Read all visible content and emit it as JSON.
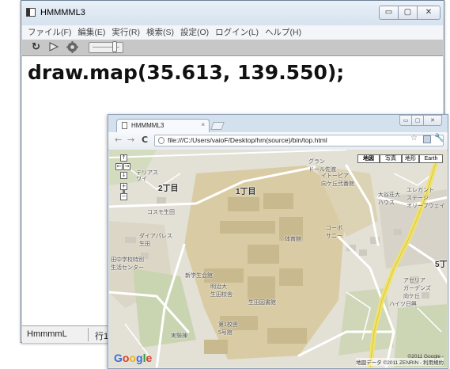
{
  "main_window": {
    "title": "HMMMML3",
    "controls": {
      "minimize": "▭",
      "maximize": "▢",
      "close": "✕"
    },
    "menu": [
      "ファイル(F)",
      "編集(E)",
      "実行(R)",
      "検索(S)",
      "設定(O)",
      "ログイン(L)",
      "ヘルプ(H)"
    ],
    "toolbar": {
      "reload_icon": "reload-icon",
      "play_icon": "play-icon",
      "settings_icon": "gear-icon"
    },
    "editor": {
      "code": "draw.map(35.613, 139.550);"
    },
    "status": {
      "name": "HmmmmL",
      "line": "行1"
    }
  },
  "browser": {
    "tab_title": "HMMMML3",
    "tab_close": "×",
    "url": "file:///C:/Users/vaioF/Desktop/hm(source)/bin/top.html",
    "map": {
      "types": [
        "地図",
        "写真",
        "地形",
        "Earth"
      ],
      "active_type": "地図",
      "labels": {
        "chome2": "2丁目",
        "chome1": "1丁目",
        "chome5": "5丁",
        "terrace": "テリアス",
        "wai": "ワイ",
        "kosumo": "コスモ生田",
        "daiapalace": "ダイアパレス\n生田",
        "school": "田中学校特別\n生活センター",
        "gran": "グラン\nドール佐渡",
        "eterna": "イトーピア\n向ケ丘弐番館",
        "elegant": "エレガント\nステージ\nオリーブウェイ",
        "ogisoi": "大谷荘大\nハウス",
        "kopo": "コーポ\nサニー",
        "acerea": "アセリア\nガーデンズ\n向ケ丘",
        "heights": "ハイツ日興",
        "library": "生田図書館",
        "taiikukan": "体育館",
        "scitech": "新学生会館",
        "meiji": "明治大\n生田校舎",
        "building": "第1校舎\n5号館",
        "rikagaku": "実験棟"
      },
      "attribution": "地図データ ©2011 ZENRIN - 利用規約",
      "copyright": "©2011 Google -"
    }
  },
  "colors": {
    "accent": "#3b6fd8",
    "campus": "#d9cba3",
    "road_yellow": "#f1e36a",
    "map_bg": "#e2dfd4"
  }
}
